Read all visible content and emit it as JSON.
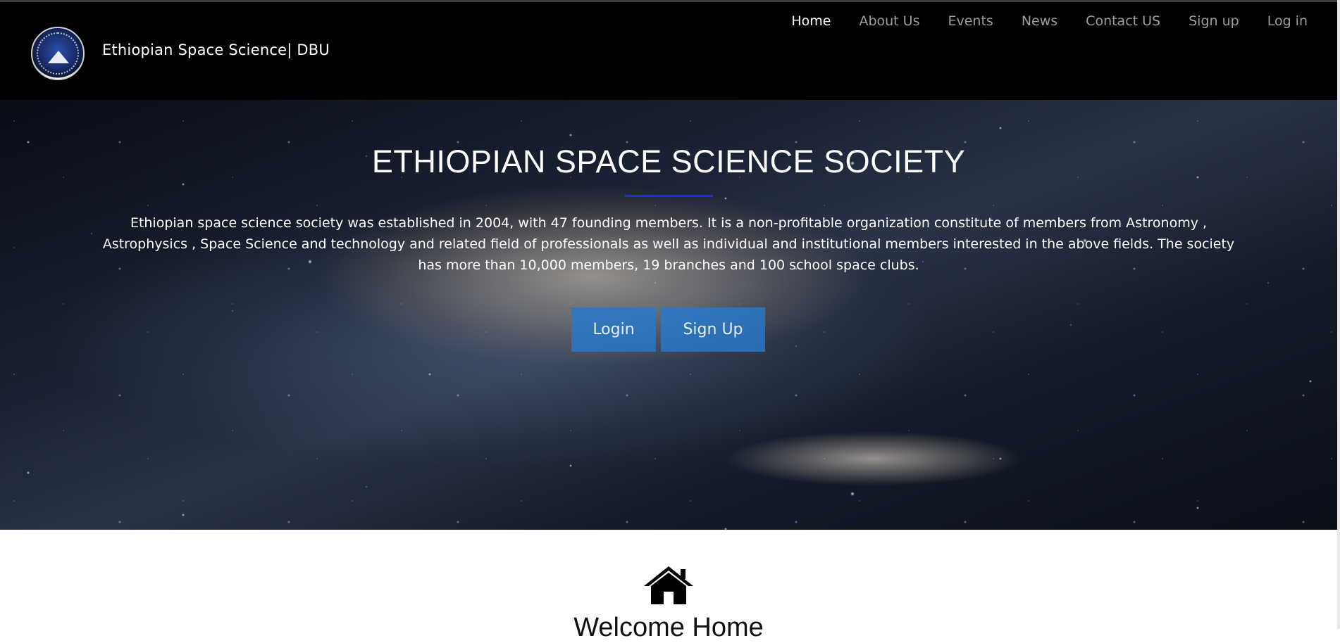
{
  "brand": {
    "name": "Ethiopian Space Science| DBU"
  },
  "nav": {
    "items": [
      {
        "label": "Home",
        "active": true
      },
      {
        "label": "About Us",
        "active": false
      },
      {
        "label": "Events",
        "active": false
      },
      {
        "label": "News",
        "active": false
      },
      {
        "label": "Contact US",
        "active": false
      },
      {
        "label": "Sign up",
        "active": false
      },
      {
        "label": "Log in",
        "active": false
      }
    ]
  },
  "hero": {
    "title": "ETHIOPIAN SPACE SCIENCE SOCIETY",
    "description": "Ethiopian space science society was established in 2004, with 47 founding members. It is a non-profitable organization constitute of members from Astronomy , Astrophysics , Space Science and technology and related field of professionals as well as individual and institutional members interested in the above fields. The society has more than 10,000 members, 19 branches and 100 school space clubs.",
    "login_label": "Login",
    "signup_label": "Sign Up"
  },
  "home_section": {
    "icon": "home-icon",
    "heading": "Welcome Home"
  },
  "colors": {
    "navbar": "#000000",
    "divider": "#1e2fd1",
    "button": "#2878c8",
    "nav_inactive": "#9d9d9d",
    "nav_active": "#ffffff"
  }
}
